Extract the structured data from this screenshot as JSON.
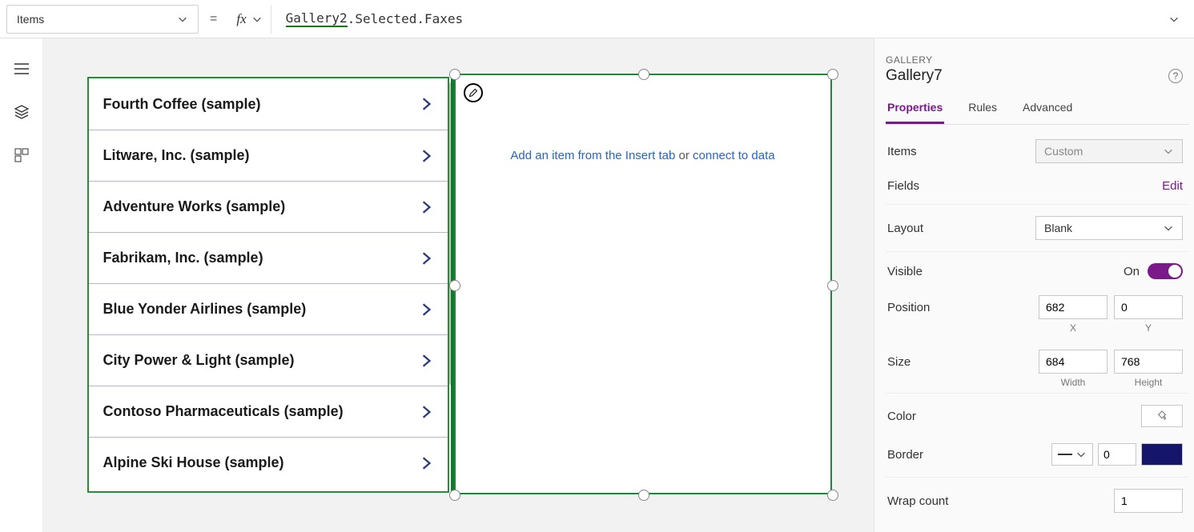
{
  "formula_bar": {
    "property": "Items",
    "equals": "=",
    "formula_ref": "Gallery2",
    "formula_rest": ".Selected.Faxes"
  },
  "gallery1_items": [
    "Fourth Coffee (sample)",
    "Litware, Inc. (sample)",
    "Adventure Works (sample)",
    "Fabrikam, Inc. (sample)",
    "Blue Yonder Airlines (sample)",
    "City Power & Light (sample)",
    "Contoso Pharmaceuticals (sample)",
    "Alpine Ski House (sample)"
  ],
  "empty_gallery": {
    "insert_link": "Add an item from the Insert tab",
    "or": " or ",
    "connect_link": "connect to data"
  },
  "panel": {
    "type_label": "GALLERY",
    "control_name": "Gallery7",
    "tabs": {
      "properties": "Properties",
      "rules": "Rules",
      "advanced": "Advanced"
    },
    "items_label": "Items",
    "items_value": "Custom",
    "fields_label": "Fields",
    "fields_edit": "Edit",
    "layout_label": "Layout",
    "layout_value": "Blank",
    "visible_label": "Visible",
    "visible_value": "On",
    "position_label": "Position",
    "position_x": "682",
    "position_y": "0",
    "x_label": "X",
    "y_label": "Y",
    "size_label": "Size",
    "size_w": "684",
    "size_h": "768",
    "w_label": "Width",
    "h_label": "Height",
    "color_label": "Color",
    "border_label": "Border",
    "border_width": "0",
    "wrap_label": "Wrap count",
    "wrap_value": "1"
  }
}
